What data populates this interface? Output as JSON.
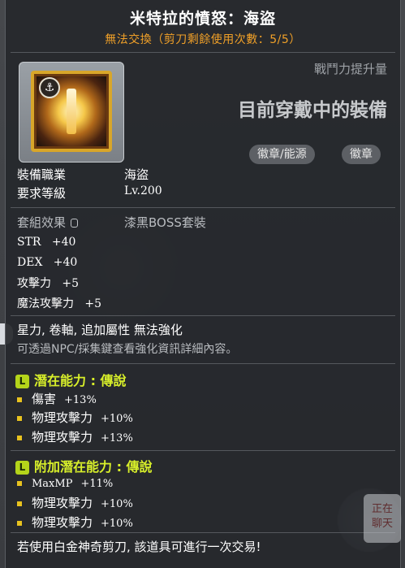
{
  "item": {
    "title": "米特拉的憤怒：海盜",
    "trade_note": "無法交換（剪刀剩餘使用次數：5/5）"
  },
  "header": {
    "combat_power_label": "戰鬥力提升量",
    "equipped_label": "目前穿戴中的裝備",
    "tags": [
      "徽章/能源",
      "徽章"
    ]
  },
  "requirements": {
    "job_label": "裝備職業",
    "job_value": "海盜",
    "level_label": "要求等級",
    "level_value": "Lv.200"
  },
  "set": {
    "label": "套組效果",
    "value": "漆黑BOSS套裝"
  },
  "stats": [
    {
      "key": "STR",
      "value": "+40"
    },
    {
      "key": "DEX",
      "value": "+40"
    },
    {
      "key": "攻擊力",
      "value": "+5"
    },
    {
      "key": "魔法攻擊力",
      "value": "+5"
    }
  ],
  "notes": {
    "restriction": "星力, 卷軸, 追加屬性 無法強化",
    "hint": "可透過NPC/採集鍵查看強化資訊詳細內容。"
  },
  "potential": {
    "badge": "L",
    "header": "潛在能力 : 傳說",
    "lines": [
      {
        "name": "傷害",
        "value": "+13%"
      },
      {
        "name": "物理攻擊力",
        "value": "+10%"
      },
      {
        "name": "物理攻擊力",
        "value": "+13%"
      }
    ]
  },
  "bonus_potential": {
    "badge": "L",
    "header": "附加潛在能力 : 傳說",
    "lines": [
      {
        "name": "MaxMP",
        "value": "+11%"
      },
      {
        "name": "物理攻擊力",
        "value": "+10%"
      },
      {
        "name": "物理攻擊力",
        "value": "+10%"
      }
    ]
  },
  "footer": "若使用白金神奇剪刀, 該道具可進行一次交易!",
  "side_button": {
    "line1": "正在",
    "line2": "聊天"
  },
  "colors": {
    "title": "#ffffff",
    "trade_note": "#f0a028",
    "potential": "#d8ef2a",
    "bullet": "#e8c21f"
  }
}
